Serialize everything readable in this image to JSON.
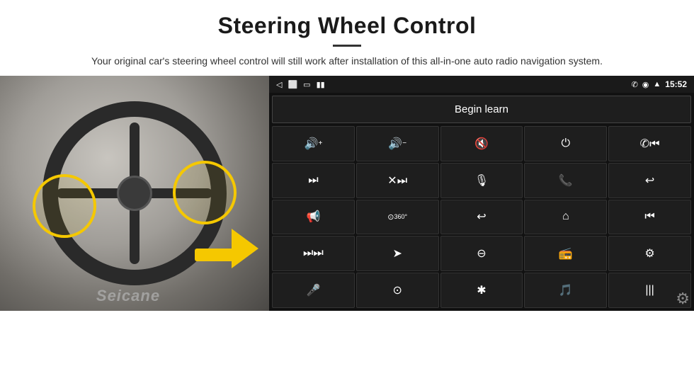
{
  "header": {
    "title": "Steering Wheel Control",
    "subtitle": "Your original car's steering wheel control will still work after installation of this all-in-one auto radio navigation system."
  },
  "screen": {
    "status_bar": {
      "back_icon": "◁",
      "home_icon": "⬜",
      "recent_icon": "▭",
      "signal_icon": "▮▮",
      "phone_icon": "✆",
      "location_icon": "◉",
      "wifi_icon": "▲",
      "time": "15:52"
    },
    "begin_learn_label": "Begin learn",
    "grid_rows": [
      [
        "🔊+",
        "🔊−",
        "🔇",
        "⏻",
        "✆⏮"
      ],
      [
        "⏭|",
        "✕⏭",
        "🎙",
        "✆",
        "↩"
      ],
      [
        "📢",
        "360°",
        "↩",
        "⌂",
        "⏮⏮"
      ],
      [
        "⏭⏭",
        "➤",
        "⊖",
        "📻",
        "⚙"
      ],
      [
        "🎤",
        "⊙",
        "✱",
        "🎵",
        "|||"
      ]
    ],
    "gear_icon": "⚙"
  },
  "watermark": "Seicane"
}
